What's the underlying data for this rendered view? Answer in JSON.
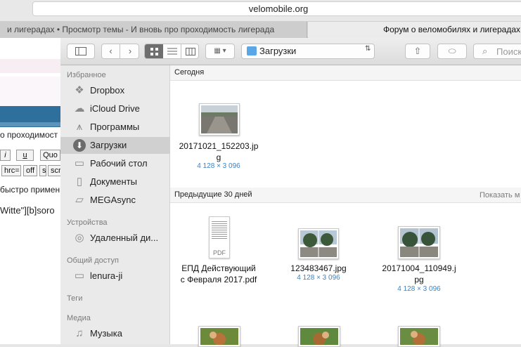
{
  "browser": {
    "url": "velomobile.org",
    "tabs": [
      {
        "title": "и лигерадах • Просмотр темы - И вновь про проходимость лигерада"
      },
      {
        "title": "Форум о веломобилях и лигерадах"
      }
    ]
  },
  "background_page": {
    "line1": "о проходимост",
    "buttons": [
      "i",
      "u",
      "Quo",
      "hrc=",
      "off",
      "s",
      "scr"
    ],
    "line2": "быстро примен",
    "line3": "Witte\"][b]soro"
  },
  "finder": {
    "toolbar": {
      "location": "Загрузки",
      "search_placeholder": "Поиск"
    },
    "sidebar": {
      "favorites_header": "Избранное",
      "favorites": [
        {
          "label": "Dropbox",
          "icon": "dropbox-icon"
        },
        {
          "label": "iCloud Drive",
          "icon": "cloud-icon"
        },
        {
          "label": "Программы",
          "icon": "applications-icon"
        },
        {
          "label": "Загрузки",
          "icon": "downloads-icon"
        },
        {
          "label": "Рабочий стол",
          "icon": "desktop-icon"
        },
        {
          "label": "Документы",
          "icon": "documents-icon"
        },
        {
          "label": "MEGAsync",
          "icon": "folder-icon"
        }
      ],
      "devices_header": "Устройства",
      "devices": [
        {
          "label": "Удаленный ди...",
          "icon": "disc-icon"
        }
      ],
      "shared_header": "Общий доступ",
      "shared": [
        {
          "label": "lenura-ji",
          "icon": "computer-icon"
        }
      ],
      "tags_header": "Теги",
      "media_header": "Медиа",
      "media": [
        {
          "label": "Музыка",
          "icon": "music-icon"
        }
      ]
    },
    "sections": {
      "today": {
        "title": "Сегодня",
        "files": [
          {
            "name_line1": "20171021_152203.jp",
            "name_line2": "g",
            "dims": "4 128 × 3 096"
          }
        ]
      },
      "previous": {
        "title": "Предыдущие 30 дней",
        "show_more": "Показать м",
        "files": [
          {
            "name_line1": "ЕПД Действующий",
            "name_line2": "с Февраля 2017.pdf",
            "dims": "",
            "pdf_label": "PDF"
          },
          {
            "name_line1": "123483467.jpg",
            "name_line2": "",
            "dims": "4 128 × 3 096"
          },
          {
            "name_line1": "20171004_110949.j",
            "name_line2": "pg",
            "dims": "4 128 × 3 096"
          }
        ]
      }
    }
  }
}
